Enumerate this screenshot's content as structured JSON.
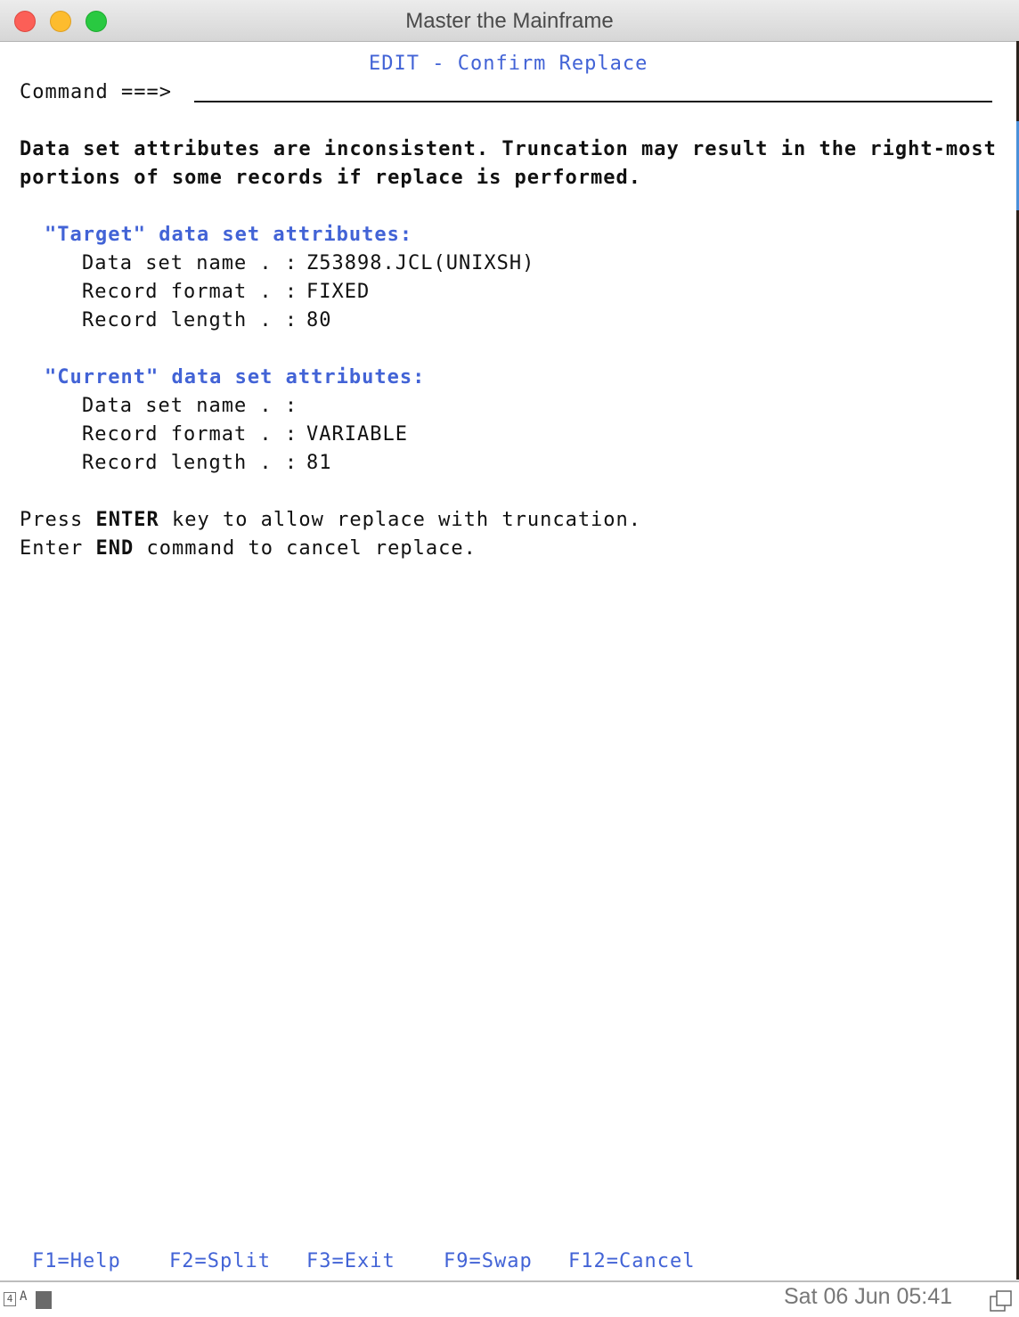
{
  "window": {
    "title": "Master the Mainframe"
  },
  "screen": {
    "panel_title": "EDIT - Confirm Replace",
    "command_label": "Command ===>",
    "command_value": "",
    "warning_line1": "Data set attributes are inconsistent. Truncation may result in the right-most",
    "warning_line2": "portions of some records if replace is performed.",
    "target": {
      "heading": "\"Target\" data set attributes:",
      "name_label": "Data set name . :",
      "name_value": "Z53898.JCL(UNIXSH)",
      "format_label": "Record format . :",
      "format_value": "FIXED",
      "length_label": "Record length . :",
      "length_value": "80"
    },
    "current": {
      "heading": "\"Current\" data set attributes:",
      "name_label": "Data set name . :",
      "name_value": "",
      "format_label": "Record format . :",
      "format_value": "VARIABLE",
      "length_label": "Record length . :",
      "length_value": "81"
    },
    "instructions": {
      "line1_pre": "Press",
      "line1_key": "ENTER",
      "line1_post": "key to allow replace with truncation.",
      "line2_pre": "Enter",
      "line2_key": "END",
      "line2_post": "command to cancel replace."
    },
    "function_keys": [
      "F1=Help",
      "F2=Split",
      "F3=Exit",
      "F9=Swap",
      "F12=Cancel"
    ]
  },
  "status_bar": {
    "session_indicator": "4",
    "lock_indicator": "A",
    "clock": "Sat 06 Jun 05:41"
  },
  "colors": {
    "protected_field": "#4263d6",
    "emphasis_text": "#111111"
  }
}
